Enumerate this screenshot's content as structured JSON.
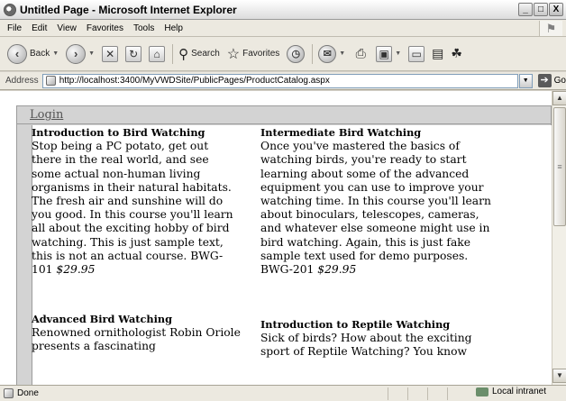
{
  "window": {
    "title": "Untitled Page - Microsoft Internet Explorer",
    "minimize": "_",
    "maximize": "□",
    "close": "X"
  },
  "menu": [
    {
      "label": "File"
    },
    {
      "label": "Edit"
    },
    {
      "label": "View"
    },
    {
      "label": "Favorites"
    },
    {
      "label": "Tools"
    },
    {
      "label": "Help"
    }
  ],
  "toolbar": {
    "back": "Back",
    "search": "Search",
    "favorites": "Favorites"
  },
  "address": {
    "label": "Address",
    "url": "http://localhost:3400/MyVWDSite/PublicPages/ProductCatalog.aspx",
    "go": "Go"
  },
  "page": {
    "login": "Login",
    "courses": [
      {
        "name": "Introduction to Bird Watching",
        "description": "Stop being a PC potato, get out there in the real world, and see some actual non-human living organisms in their natural habitats. The fresh air and sunshine will do you good. In this course you'll learn all about the exciting hobby of bird watching. This is just sample text, this is not an actual course. BWG-101",
        "price": "$29.95"
      },
      {
        "name": "Intermediate Bird Watching",
        "description": "Once you've mastered the basics of watching birds, you're ready to start learning about some of the advanced equipment you can use to improve your watching time. In this course you'll learn about binoculars, telescopes, cameras, and whatever else someone might use in bird watching. Again, this is just fake sample text used for demo purposes. BWG-201",
        "price": "$29.95"
      },
      {
        "name": "Advanced Bird Watching",
        "description": "Renowned ornithologist Robin Oriole presents a fascinating"
      },
      {
        "name": "Introduction to Reptile Watching",
        "description": "Sick of birds? How about the exciting sport of Reptile Watching? You know"
      }
    ]
  },
  "status": {
    "text": "Done",
    "zone": "Local intranet"
  }
}
